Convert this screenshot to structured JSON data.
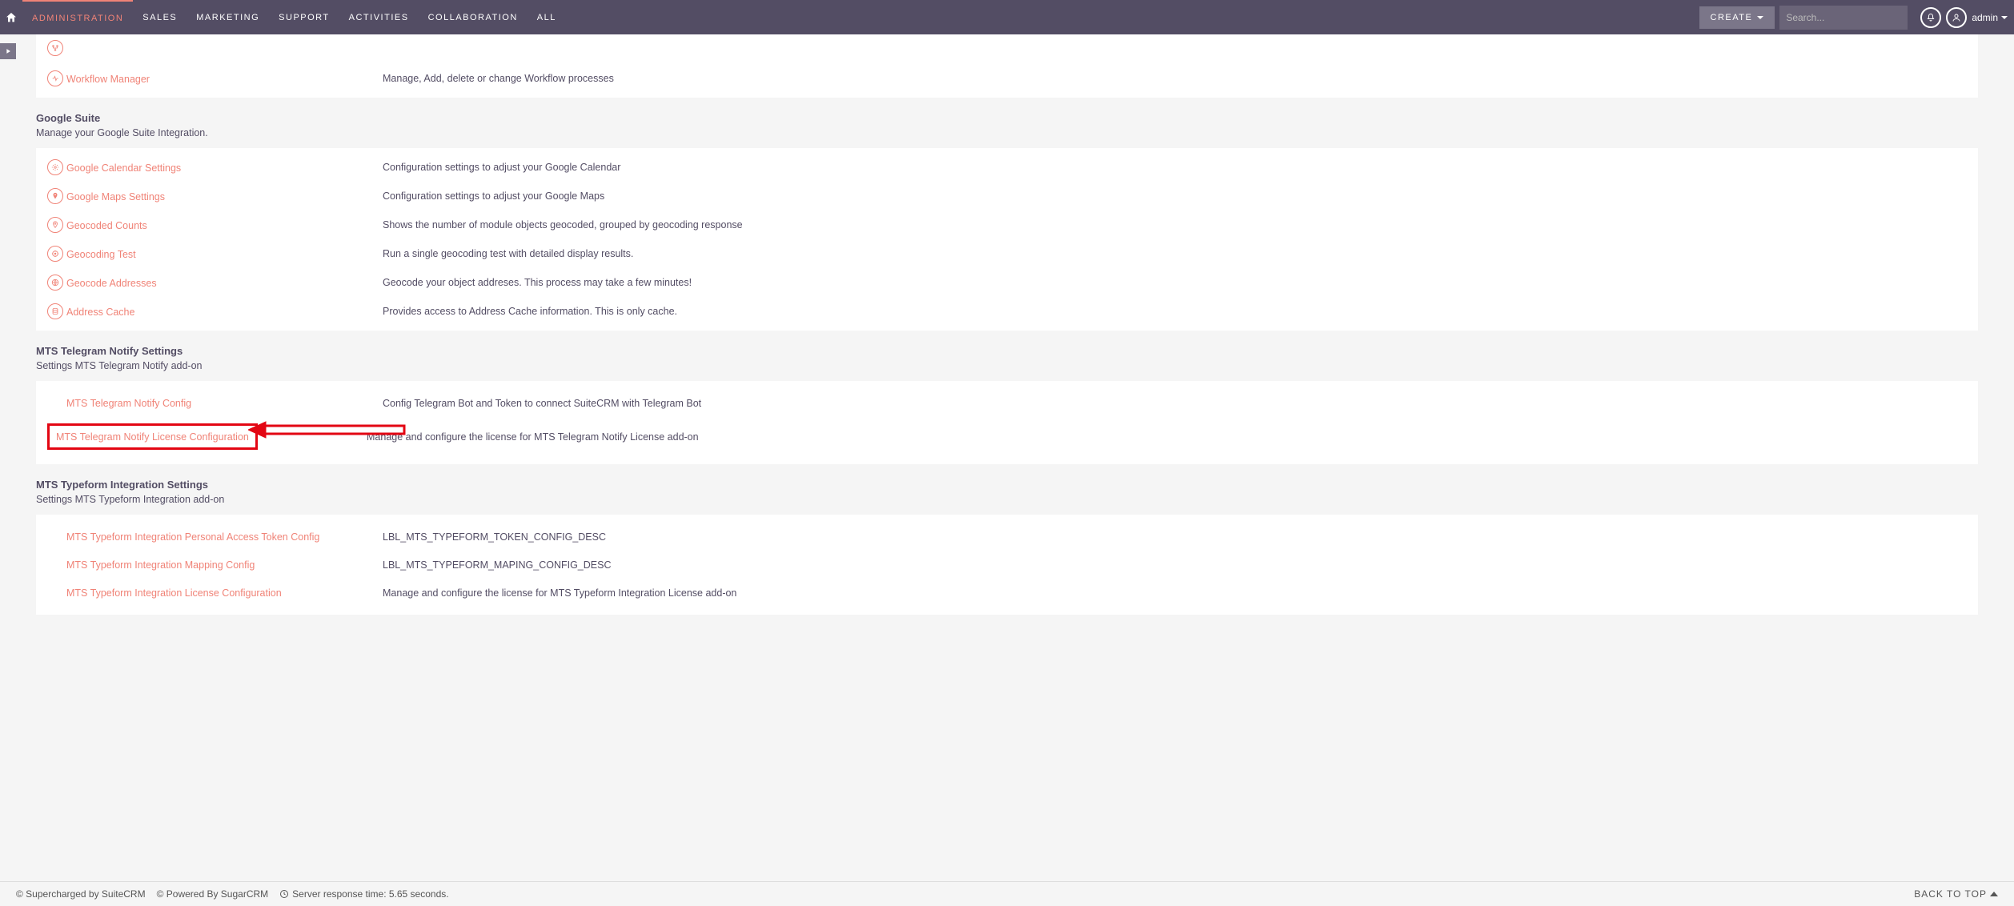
{
  "nav": {
    "tabs": [
      "ADMINISTRATION",
      "SALES",
      "MARKETING",
      "SUPPORT",
      "ACTIVITIES",
      "COLLABORATION",
      "ALL"
    ],
    "active": "ADMINISTRATION",
    "create": "CREATE",
    "search_placeholder": "Search...",
    "user": "admin"
  },
  "sections": [
    {
      "rows": [
        {
          "icon": "wf",
          "link": "Workflow Manager",
          "desc": "Manage, Add, delete or change Workflow processes"
        }
      ]
    }
  ],
  "google": {
    "title": "Google Suite",
    "sub": "Manage your Google Suite Integration.",
    "rows": [
      {
        "icon": "gear",
        "link": "Google Calendar Settings",
        "desc": "Configuration settings to adjust your Google Calendar"
      },
      {
        "icon": "pin",
        "link": "Google Maps Settings",
        "desc": "Configuration settings to adjust your Google Maps"
      },
      {
        "icon": "pin",
        "link": "Geocoded Counts",
        "desc": "Shows the number of module objects geocoded, grouped by geocoding response"
      },
      {
        "icon": "target",
        "link": "Geocoding Test",
        "desc": "Run a single geocoding test with detailed display results."
      },
      {
        "icon": "globe",
        "link": "Geocode Addresses",
        "desc": "Geocode your object addreses. This process may take a few minutes!"
      },
      {
        "icon": "db",
        "link": "Address Cache",
        "desc": "Provides access to Address Cache information. This is only cache."
      }
    ]
  },
  "telegram": {
    "title": "MTS Telegram Notify Settings",
    "sub": "Settings MTS Telegram Notify add-on",
    "rows": [
      {
        "link": "MTS Telegram Notify Config",
        "desc": "Config Telegram Bot and Token to connect SuiteCRM with Telegram Bot"
      },
      {
        "link": "MTS Telegram Notify License Configuration",
        "desc": "Manage and configure the license for MTS Telegram Notify License add-on",
        "highlight": true
      }
    ]
  },
  "typeform": {
    "title": "MTS Typeform Integration Settings",
    "sub": "Settings MTS Typeform Integration add-on",
    "rows": [
      {
        "link": "MTS Typeform Integration Personal Access Token Config",
        "desc": "LBL_MTS_TYPEFORM_TOKEN_CONFIG_DESC"
      },
      {
        "link": "MTS Typeform Integration Mapping Config",
        "desc": "LBL_MTS_TYPEFORM_MAPING_CONFIG_DESC"
      },
      {
        "link": "MTS Typeform Integration License Configuration",
        "desc": "Manage and configure the license for MTS Typeform Integration License add-on"
      }
    ]
  },
  "footer": {
    "supercharged": "© Supercharged by SuiteCRM",
    "powered": "© Powered By SugarCRM",
    "server": "Server response time: 5.65 seconds.",
    "backtotop": "BACK TO TOP"
  }
}
